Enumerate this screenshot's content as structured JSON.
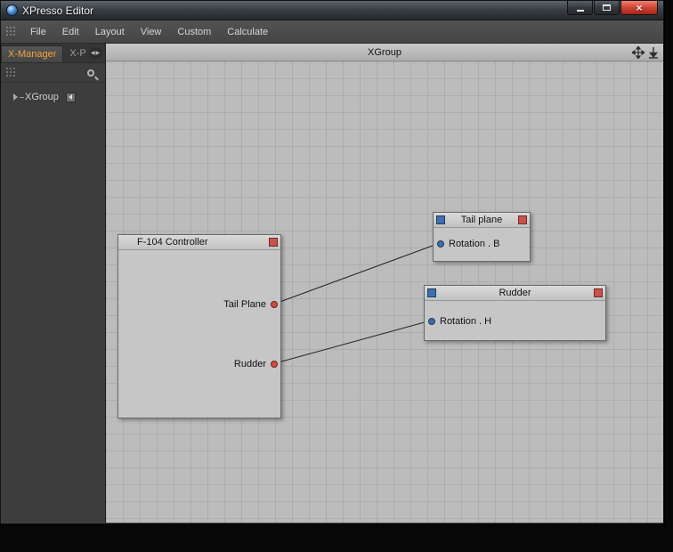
{
  "window": {
    "title": "XPresso Editor",
    "close_glyph": "×"
  },
  "menubar": {
    "items": [
      "File",
      "Edit",
      "Layout",
      "View",
      "Custom",
      "Calculate"
    ]
  },
  "sidebar": {
    "tabs": [
      {
        "label": "X-Manager",
        "active": true
      },
      {
        "label": "X-P",
        "active": false
      }
    ],
    "tree": {
      "label": "XGroup"
    }
  },
  "canvas": {
    "header": {
      "title": "XGroup"
    },
    "nodes": [
      {
        "title": "F-104 Controller",
        "outputs": [
          {
            "label": "Tail Plane",
            "port_color": "#d04b40"
          },
          {
            "label": "Rudder",
            "port_color": "#d04b40"
          }
        ]
      },
      {
        "title": "Tail plane",
        "inputs": [
          {
            "label": "Rotation . B",
            "port_color": "#3d6ea5"
          }
        ]
      },
      {
        "title": "Rudder",
        "inputs": [
          {
            "label": "Rotation . H",
            "port_color": "#3d6ea5"
          }
        ]
      }
    ],
    "connections": [
      {
        "from": "F-104 Controller.Tail Plane",
        "to": "Tail plane.Rotation . B"
      },
      {
        "from": "F-104 Controller.Rudder",
        "to": "Rudder.Rotation . H"
      }
    ]
  },
  "colors": {
    "accent_orange": "#f2a23c",
    "port_red": "#d04b40",
    "port_blue": "#3d6ea5",
    "header_square_red": "#c9524a",
    "header_square_blue": "#3f6fae",
    "canvas_bg": "#bcbcbc"
  }
}
